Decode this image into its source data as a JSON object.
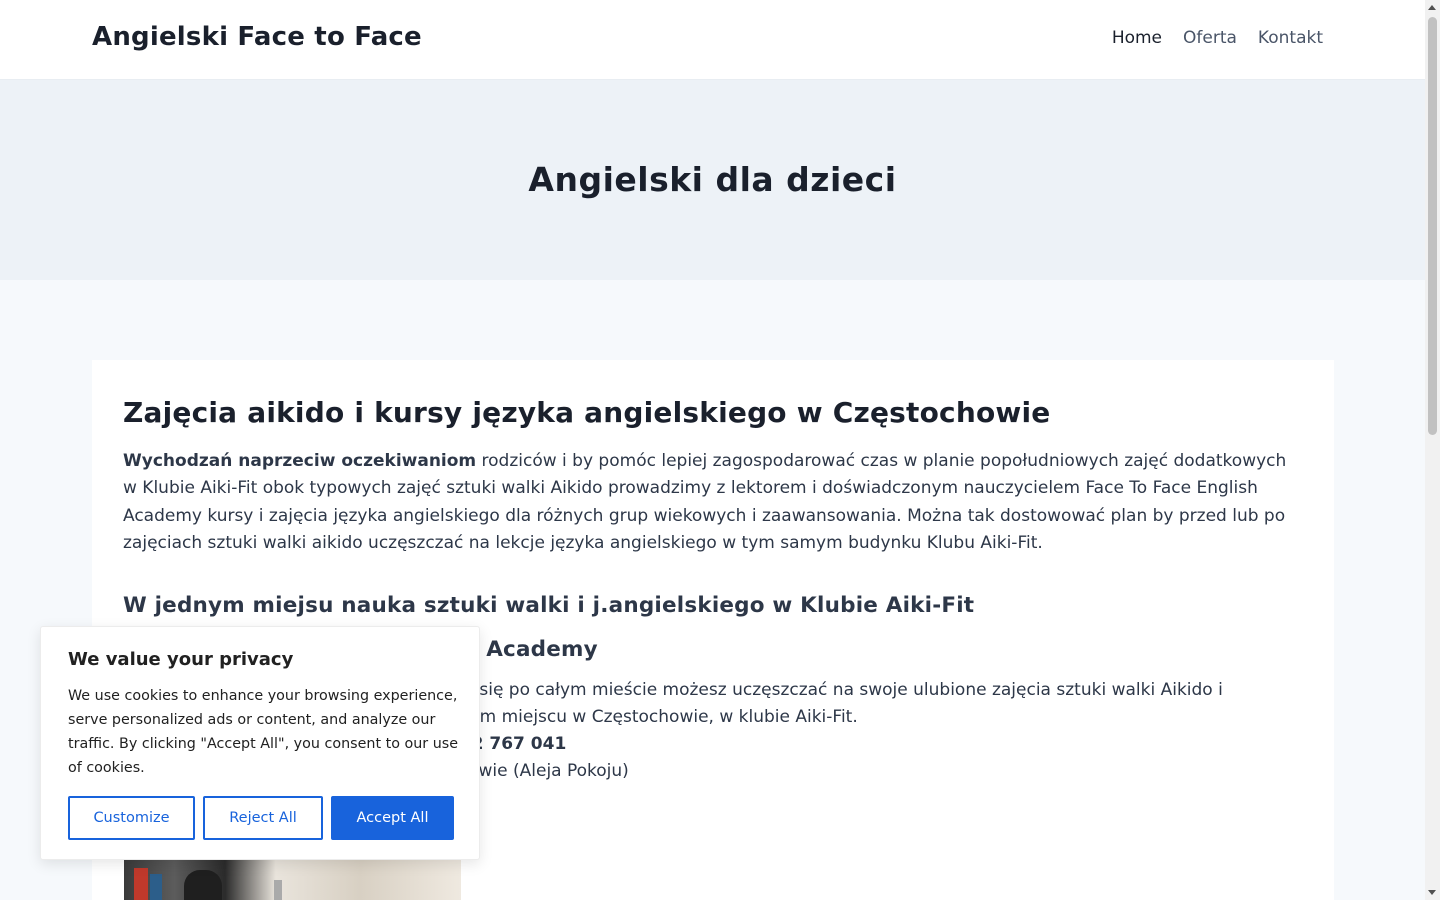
{
  "header": {
    "brand": "Angielski Face to Face",
    "nav": [
      {
        "label": "Home"
      },
      {
        "label": "Oferta"
      },
      {
        "label": "Kontakt"
      }
    ]
  },
  "hero": {
    "title": "Angielski dla dzieci"
  },
  "content": {
    "heading": "Zajęcia aikido i kursy języka angielskiego w Częstochowie",
    "intro_bold": "Wychodzań naprzeciw oczekiwaniom",
    "intro_rest": " rodziców i by pomóc lepiej zagospodarować czas w planie popołudniowych zajęć dodatkowych w Klubie Aiki-Fit obok typowych zajęć sztuki walki Aikido prowadzimy z lektorem i doświadczonym nauczycielem Face To Face English Academy kursy i zajęcia języka angielskiego dla różnych grup wiekowych i zaawansowania. Można tak dostowować plan by przed lub po zajęciach sztuki walki aikido uczęszczać na lekcje języka angielskiego w tym samym budynku Klubu Aiki-Fit.",
    "subheading1": "W jednym miejsu nauka sztuki walki  i  j.angielskiego w Klubie Aiki-Fit",
    "subheading2_visible": "sh Academy",
    "line1_visible": "nie się po całym mieście możesz uczęszczać na swoje ulubione zajęcia sztuki walki Aikido i",
    "line2_visible": "dnym miejscu w Częstochowie, w klubie Aiki-Fit.",
    "line3_visible": "602 767 041",
    "line4_visible": "chowie (Aleja Pokoju)"
  },
  "cookie": {
    "title": "We value your privacy",
    "text": "We use cookies to enhance your browsing experience, serve personalized ads or content, and analyze our traffic. By clicking \"Accept All\", you consent to our use of cookies.",
    "customize": "Customize",
    "reject": "Reject All",
    "accept": "Accept All"
  },
  "colors": {
    "accent": "#1863dc",
    "hero_bg": "#edf2f7",
    "page_bg": "#f6f9fc",
    "text": "#1a202c"
  }
}
